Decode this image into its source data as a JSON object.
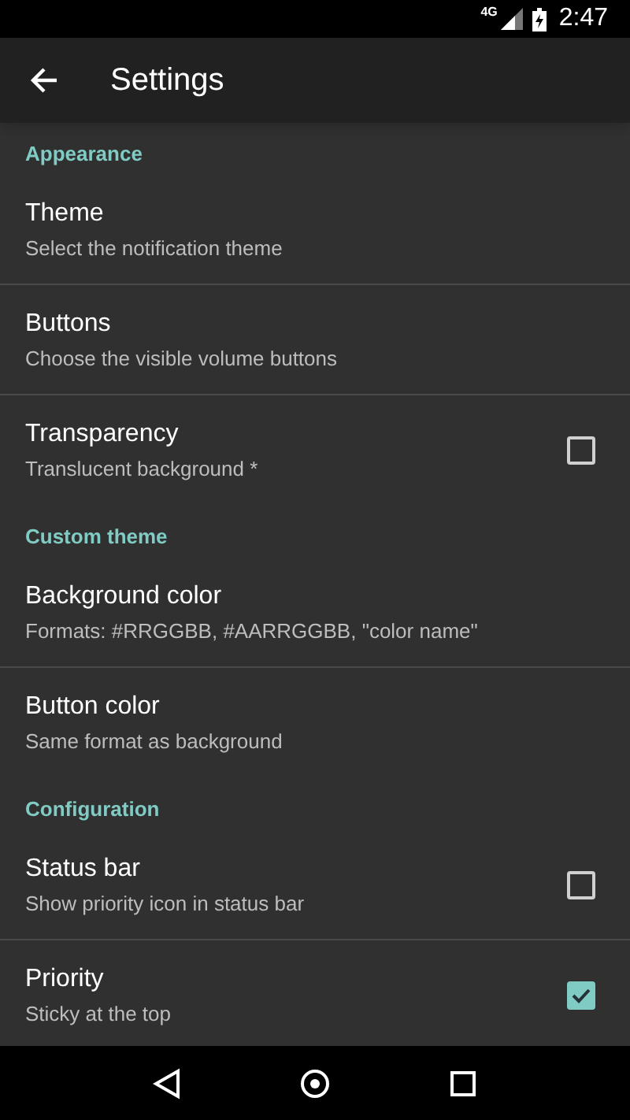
{
  "status_bar": {
    "network": "4G",
    "time": "2:47"
  },
  "app_bar": {
    "title": "Settings"
  },
  "sections": [
    {
      "header": "Appearance",
      "items": [
        {
          "kind": "plain",
          "title": "Theme",
          "subtitle": "Select the notification theme"
        },
        {
          "kind": "plain",
          "title": "Buttons",
          "subtitle": "Choose the visible volume buttons"
        },
        {
          "kind": "checkbox",
          "title": "Transparency",
          "subtitle": "Translucent background *",
          "checked": false
        }
      ]
    },
    {
      "header": "Custom theme",
      "items": [
        {
          "kind": "plain",
          "title": "Background color",
          "subtitle": "Formats: #RRGGBB, #AARRGGBB, \"color name\""
        },
        {
          "kind": "plain",
          "title": "Button color",
          "subtitle": "Same format as background"
        }
      ]
    },
    {
      "header": "Configuration",
      "items": [
        {
          "kind": "checkbox",
          "title": "Status bar",
          "subtitle": "Show priority icon in status bar",
          "checked": false
        },
        {
          "kind": "checkbox",
          "title": "Priority",
          "subtitle": "Sticky at the top",
          "checked": true
        }
      ]
    }
  ]
}
